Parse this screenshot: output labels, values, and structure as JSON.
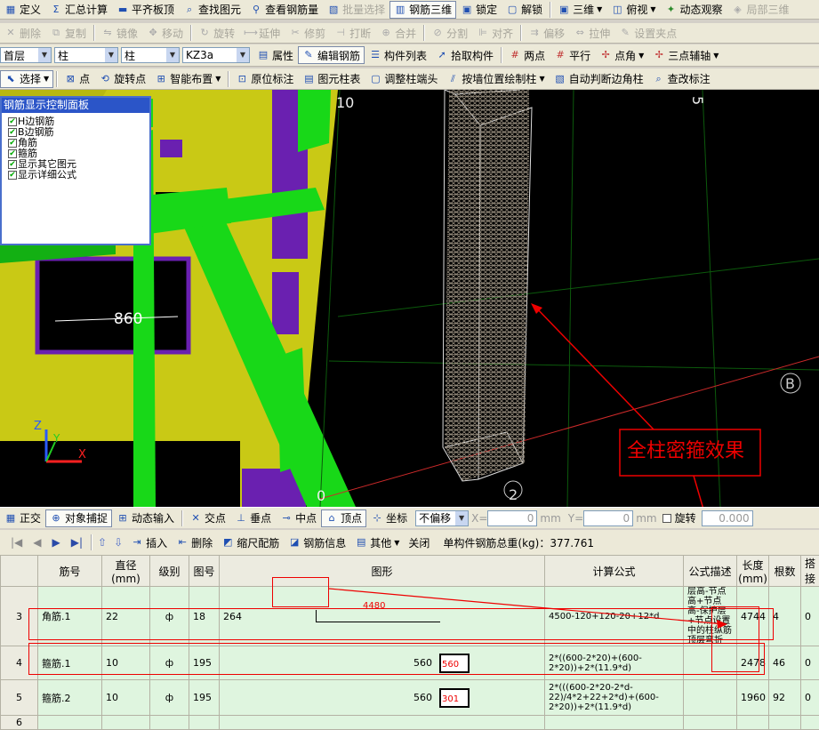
{
  "toolbar1": [
    {
      "icon": "define-icon",
      "label": "定义",
      "dis": false
    },
    {
      "icon": "sum-icon",
      "label": "汇总计算",
      "dis": false
    },
    {
      "icon": "flat-board-icon",
      "label": "平齐板顶",
      "dis": false
    },
    {
      "icon": "find-element-icon",
      "label": "查找图元",
      "dis": false
    },
    {
      "icon": "view-rebar-icon",
      "label": "查看钢筋量",
      "dis": false
    },
    {
      "icon": "batch-select-icon",
      "label": "批量选择",
      "dis": true
    },
    {
      "icon": "rebar-3d-icon",
      "label": "钢筋三维",
      "dis": false,
      "on": true
    },
    {
      "icon": "lock-icon",
      "label": "锁定",
      "dis": false
    },
    {
      "icon": "unlock-icon",
      "label": "解锁",
      "dis": false
    }
  ],
  "toolbar1_right": {
    "view_mode": "三维",
    "top_view": "俯视",
    "orbit": "动态观察",
    "local_3d": "局部三维"
  },
  "toolbar2": [
    "删除",
    "复制",
    "镜像",
    "移动",
    "旋转",
    "延伸",
    "修剪",
    "打断",
    "合并",
    "分割",
    "对齐",
    "偏移",
    "拉伸",
    "设置夹点"
  ],
  "toolbar3": {
    "floor": "首层",
    "category": "柱",
    "type": "柱",
    "member": "KZ3a",
    "props": "属性",
    "edit_rebar": "编辑钢筋",
    "list": "构件列表",
    "pick": "拾取构件",
    "two_point": "两点",
    "parallel": "平行",
    "point_angle": "点角",
    "three_point": "三点辅轴"
  },
  "toolbar4": [
    "选择",
    "点",
    "旋转点",
    "智能布置",
    "原位标注",
    "图元柱表",
    "调整柱端头",
    "按墙位置绘制柱",
    "自动判断边角柱",
    "查改标注"
  ],
  "panel": {
    "title": "钢筋显示控制面板",
    "items": [
      "H边钢筋",
      "B边钢筋",
      "角筋",
      "箍筋",
      "显示其它图元",
      "显示详细公式"
    ]
  },
  "viewport": {
    "axis10": "10",
    "axis5": "5",
    "axisB": "B",
    "axis2": "2",
    "axis0": "0",
    "dim": "860",
    "annotation": "全柱密箍效果",
    "z": "Z",
    "y": "Y",
    "x": "X"
  },
  "snapbar": {
    "ortho": "正交",
    "snap": "对象捕捉",
    "dyn": "动态输入",
    "intersect": "交点",
    "perp": "垂点",
    "mid": "中点",
    "vertex": "顶点",
    "coord": "坐标",
    "offset": "不偏移",
    "x_label": "X=",
    "x_val": "0",
    "y_label": "Y=",
    "y_val": "0",
    "unit": "mm",
    "rotate": "旋转",
    "rotate_val": "0.000"
  },
  "navbar": {
    "insert": "插入",
    "delete": "删除",
    "scale": "缩尺配筋",
    "info": "钢筋信息",
    "other": "其他",
    "close": "关闭",
    "total": "单构件钢筋总重(kg)：377.761"
  },
  "table": {
    "headers": [
      "",
      "筋号",
      "直径(mm)",
      "级别",
      "图号",
      "图形",
      "计算公式",
      "公式描述",
      "长度(mm)",
      "根数",
      "搭接",
      "损耗"
    ],
    "rows": [
      {
        "n": "3",
        "name": "角筋.1",
        "dia": "22",
        "grade": "ф",
        "fig": "18",
        "shape_l": "264",
        "shape_v": "4480",
        "formula": "4500-120+120-20+12*d",
        "desc": "层高-节点高+节点高-保护层+节点设置中的柱纵筋顶层弯折",
        "len": "4744",
        "count": "4",
        "lap": "0",
        "loss": "3"
      },
      {
        "n": "4",
        "name": "箍筋.1",
        "dia": "10",
        "grade": "ф",
        "fig": "195",
        "shape_l": "560",
        "shape_v": "560",
        "formula": "2*((600-2*20)+(600-2*20))+2*(11.9*d)",
        "desc": "",
        "len": "2478",
        "count": "46",
        "lap": "0",
        "loss": "3"
      },
      {
        "n": "5",
        "name": "箍筋.2",
        "dia": "10",
        "grade": "ф",
        "fig": "195",
        "shape_l": "560",
        "shape_v": "301",
        "formula": "2*(((600-2*20-2*d-22)/4*2+22+2*d)+(600-2*20))+2*(11.9*d)",
        "desc": "",
        "len": "1960",
        "count": "92",
        "lap": "0",
        "loss": "3"
      },
      {
        "n": "6",
        "name": "",
        "dia": "",
        "grade": "",
        "fig": "",
        "shape_l": "",
        "shape_v": "",
        "formula": "",
        "desc": "",
        "len": "",
        "count": "",
        "lap": "",
        "loss": ""
      }
    ]
  }
}
